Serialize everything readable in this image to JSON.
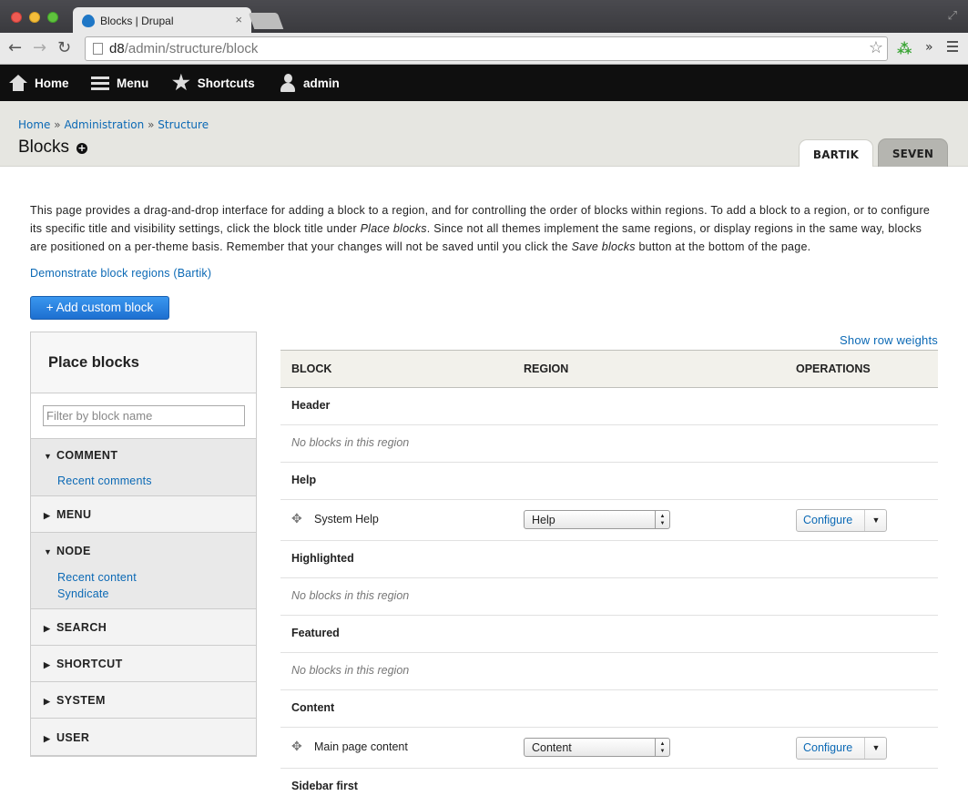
{
  "browser": {
    "tab_title": "Blocks | Drupal",
    "tab_close": "×",
    "url_host": "d8",
    "url_path": "/admin/structure/block"
  },
  "toolbar": {
    "home": "Home",
    "menu": "Menu",
    "shortcuts": "Shortcuts",
    "user": "admin"
  },
  "header": {
    "breadcrumb": [
      "Home",
      "Administration",
      "Structure"
    ],
    "breadcrumb_sep": "»",
    "title": "Blocks",
    "themes": [
      "BARTIK",
      "SEVEN"
    ]
  },
  "intro": {
    "part1": "This page provides a drag-and-drop interface for adding a block to a region, and for controlling the order of blocks within regions. To add a block to a region, or to configure its specific title and visibility settings, click the block title under ",
    "em1": "Place blocks",
    "part2": ". Since not all themes implement the same regions, or display regions in the same way, blocks are positioned on a per-theme basis. Remember that your changes will not be saved until you click the ",
    "em2": "Save blocks",
    "part3": " button at the bottom of the page."
  },
  "demo_link": "Demonstrate block regions (Bartik)",
  "add_button": "+ Add custom block",
  "place": {
    "title": "Place blocks",
    "filter_placeholder": "Filter by block name",
    "categories": [
      {
        "name": "COMMENT",
        "open": true,
        "links": [
          "Recent comments"
        ]
      },
      {
        "name": "MENU",
        "open": false,
        "links": []
      },
      {
        "name": "NODE",
        "open": true,
        "links": [
          "Recent content",
          "Syndicate"
        ]
      },
      {
        "name": "SEARCH",
        "open": false,
        "links": []
      },
      {
        "name": "SHORTCUT",
        "open": false,
        "links": []
      },
      {
        "name": "SYSTEM",
        "open": false,
        "links": []
      },
      {
        "name": "USER",
        "open": false,
        "links": []
      }
    ]
  },
  "table": {
    "show_weights": "Show row weights",
    "headers": [
      "BLOCK",
      "REGION",
      "OPERATIONS"
    ],
    "empty_text": "No blocks in this region",
    "configure": "Configure",
    "regions": {
      "header": "Header",
      "help": "Help",
      "highlighted": "Highlighted",
      "featured": "Featured",
      "content": "Content",
      "sidebar_first": "Sidebar first"
    },
    "blocks": {
      "system_help": {
        "name": "System Help",
        "region": "Help"
      },
      "main_content": {
        "name": "Main page content",
        "region": "Content"
      }
    }
  }
}
